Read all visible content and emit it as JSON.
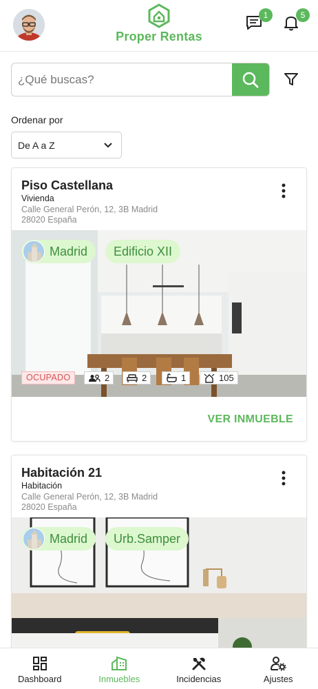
{
  "app": {
    "name": "Proper Rentas",
    "brand_color": "#5cb85c"
  },
  "header": {
    "avatar_alt": "user-avatar",
    "messages_count": "1",
    "notifications_count": "5"
  },
  "search": {
    "placeholder": "¿Qué buscas?"
  },
  "sort": {
    "label": "Ordenar por",
    "selected": "De A a Z"
  },
  "listings": [
    {
      "title": "Piso Castellana",
      "type": "Vivienda",
      "address_line1": "Calle General Perón, 12, 3B Madrid",
      "address_line2": "28020 España",
      "city_chip": "Madrid",
      "building_chip": "Edificio XII",
      "status": "OCUPADO",
      "occupants": "2",
      "beds": "2",
      "baths": "1",
      "area": "105",
      "action": "VER INMUEBLE"
    },
    {
      "title": "Habitación 21",
      "type": "Habitación",
      "address_line1": "Calle General Perón, 12, 3B Madrid",
      "address_line2": "28020 España",
      "city_chip": "Madrid",
      "building_chip": "Urb.Samper"
    }
  ],
  "bottom_nav": [
    {
      "label": "Dashboard",
      "icon": "dashboard-icon"
    },
    {
      "label": "Inmuebles",
      "icon": "building-icon",
      "active": true
    },
    {
      "label": "Incidencias",
      "icon": "tools-icon"
    },
    {
      "label": "Ajustes",
      "icon": "user-settings-icon"
    }
  ]
}
